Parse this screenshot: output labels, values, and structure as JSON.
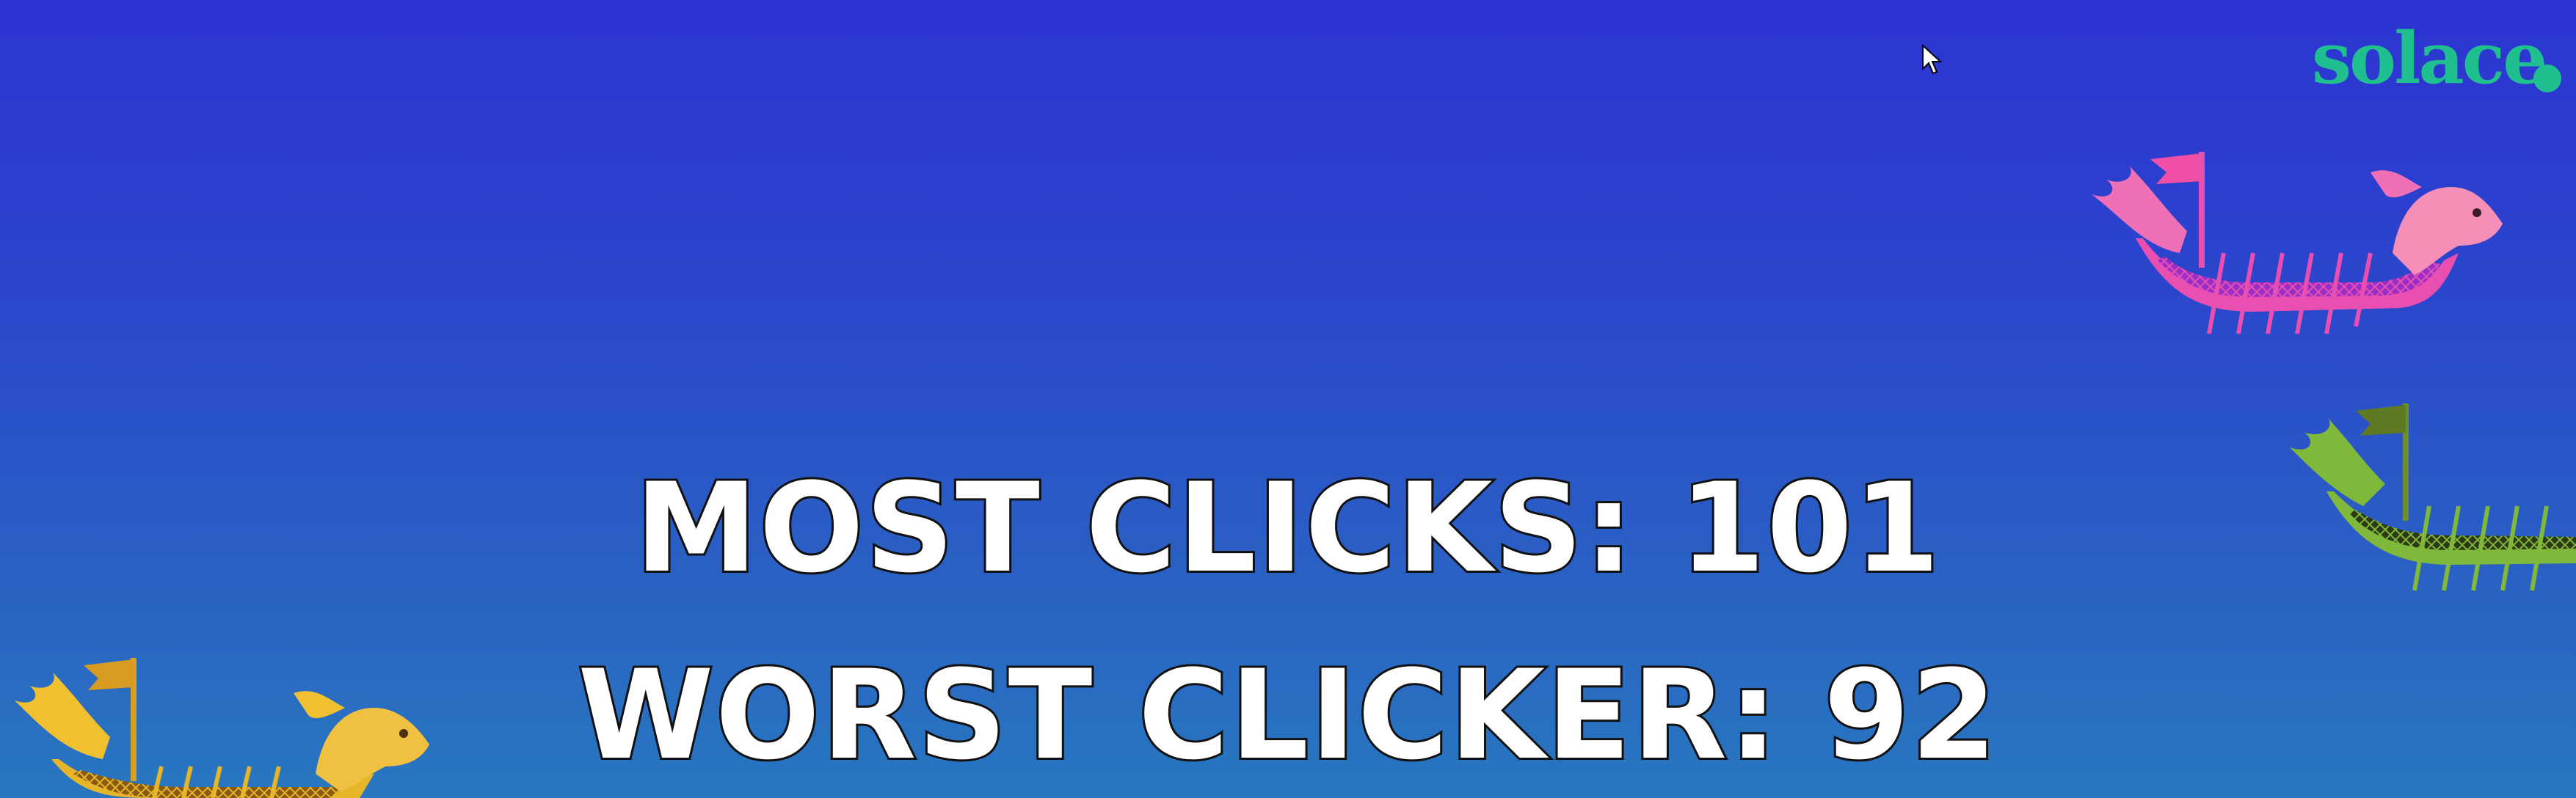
{
  "brand": {
    "logo_text": "solace",
    "logo_color": "#1fbf8f"
  },
  "stats": {
    "most_clicks": "MOST CLICKS: 101",
    "worst_clicker": "WORST CLICKER: 92"
  },
  "boats": [
    {
      "icon": "dragon-boat-icon",
      "color": "#e84fb0",
      "accent": "#9a2fc8"
    },
    {
      "icon": "dragon-boat-icon",
      "color": "#7fb83a",
      "accent": "#3a4a1a"
    },
    {
      "icon": "dragon-boat-icon",
      "color": "#e7b52a",
      "accent": "#8a5a10"
    }
  ],
  "colors": {
    "background_top": "#2c33d2",
    "background_bottom": "#2877bf",
    "text_fill": "#ffffff",
    "text_outline": "#111111"
  }
}
